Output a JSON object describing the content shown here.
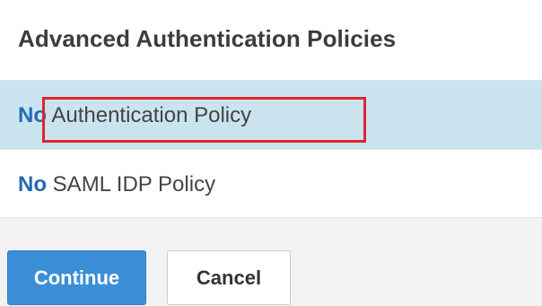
{
  "header": {
    "title": "Advanced Authentication Policies"
  },
  "policies": [
    {
      "prefix": "No",
      "name": "Authentication Policy",
      "selected": true
    },
    {
      "prefix": "No",
      "name": "SAML IDP Policy",
      "selected": false
    }
  ],
  "buttons": {
    "continue_label": "Continue",
    "cancel_label": "Cancel"
  },
  "colors": {
    "accent_blue": "#2469b3",
    "selected_row_bg": "#c9e4ef",
    "primary_button_bg": "#3b8fd6",
    "highlight_border": "#e1252f"
  }
}
